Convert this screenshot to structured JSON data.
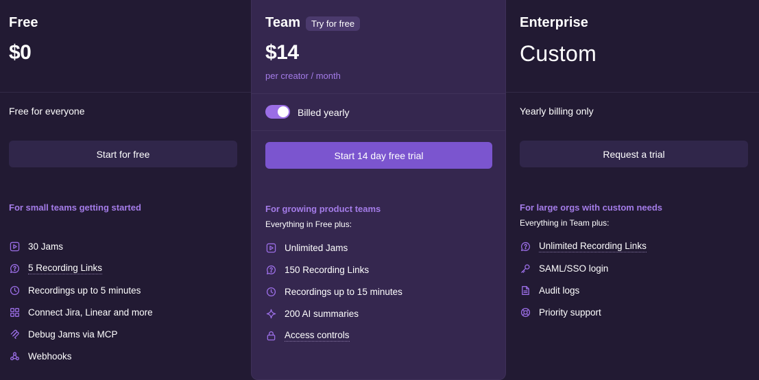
{
  "free": {
    "name": "Free",
    "price": "$0",
    "billing": "Free for everyone",
    "cta": "Start for free",
    "tagline": "For small teams getting started",
    "features": [
      {
        "icon": "play-icon",
        "label": "30 Jams"
      },
      {
        "icon": "message-question-icon",
        "label": "5 Recording Links"
      },
      {
        "icon": "clock-icon",
        "label": "Recordings up to 5 minutes"
      },
      {
        "icon": "grid-icon",
        "label": "Connect Jira, Linear and more"
      },
      {
        "icon": "mcp-icon",
        "label": "Debug Jams via MCP"
      },
      {
        "icon": "webhook-icon",
        "label": "Webhooks"
      }
    ]
  },
  "team": {
    "name": "Team",
    "badge": "Try for free",
    "price": "$14",
    "price_sub": "per creator / month",
    "billing_toggle_label": "Billed yearly",
    "billing_toggle_on": true,
    "cta": "Start 14 day free trial",
    "tagline": "For growing product teams",
    "includes": "Everything in Free plus:",
    "features": [
      {
        "icon": "play-icon",
        "label": "Unlimited Jams"
      },
      {
        "icon": "message-question-icon",
        "label": "150 Recording Links"
      },
      {
        "icon": "clock-icon",
        "label": "Recordings up to 15 minutes"
      },
      {
        "icon": "sparkle-icon",
        "label": "200 AI summaries"
      },
      {
        "icon": "lock-icon",
        "label": "Access controls"
      }
    ]
  },
  "enterprise": {
    "name": "Enterprise",
    "price": "Custom",
    "billing": "Yearly billing only",
    "cta": "Request a trial",
    "tagline": "For large orgs with custom needs",
    "includes": "Everything in Team plus:",
    "features": [
      {
        "icon": "message-question-icon",
        "label": "Unlimited Recording Links"
      },
      {
        "icon": "key-icon",
        "label": "SAML/SSO login"
      },
      {
        "icon": "document-icon",
        "label": "Audit logs"
      },
      {
        "icon": "lifebuoy-icon",
        "label": "Priority support"
      }
    ]
  },
  "colors": {
    "background": "#221a33",
    "highlight_panel": "#35274f",
    "accent": "#a47ce8",
    "primary_button": "#7b55cf",
    "secondary_button": "#30264a"
  }
}
